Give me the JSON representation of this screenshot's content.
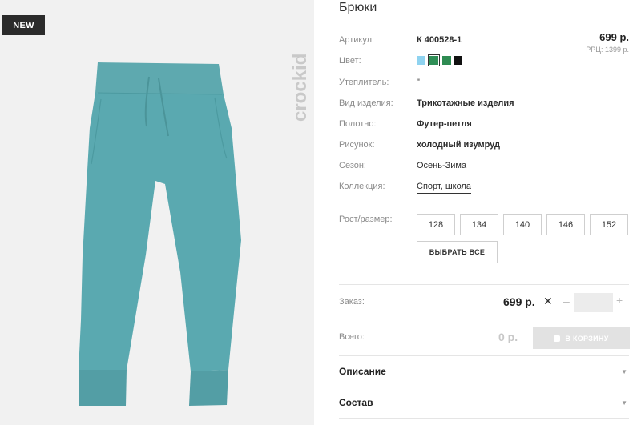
{
  "product": {
    "badge": "NEW",
    "brand": "crockid",
    "title": "Брюки",
    "price": "699 р.",
    "rrp": "РРЦ: 1399 р."
  },
  "attributes": [
    {
      "label": "Артикул:",
      "value": "К 400528-1"
    },
    {
      "label": "Цвет:",
      "value": ""
    },
    {
      "label": "Утеплитель:",
      "value": "\""
    },
    {
      "label": "Вид изделия:",
      "value": "Трикотажные изделия"
    },
    {
      "label": "Полотно:",
      "value": "Футер-петля"
    },
    {
      "label": "Рисунок:",
      "value": "холодный изумруд"
    },
    {
      "label": "Сезон:",
      "value": "Осень-Зима"
    },
    {
      "label": "Коллекция:",
      "value": "Спорт, школа"
    }
  ],
  "swatches": [
    {
      "color": "#8fd3f0",
      "icon": "color-swatch-icon"
    },
    {
      "color": "#2f8f57",
      "icon": "color-swatch-icon",
      "selected": true
    },
    {
      "color": "#2e8b52",
      "icon": "color-swatch-icon"
    },
    {
      "color": "#111111",
      "icon": "color-swatch-icon"
    }
  ],
  "sizes": {
    "label": "Рост/размер:",
    "options": [
      "128",
      "134",
      "140",
      "146",
      "152"
    ],
    "select_all": "ВЫБРАТЬ ВСЕ"
  },
  "order": {
    "label": "Заказ:",
    "price": "699 р.",
    "times": "✕",
    "minus": "–",
    "plus": "+",
    "quantity": "",
    "total_label": "Всего:",
    "total": "0 р.",
    "cart_button": "В КОРЗИНУ"
  },
  "accordion": [
    {
      "title": "Описание",
      "icon": "chevron-down-icon"
    },
    {
      "title": "Состав",
      "icon": "chevron-down-icon"
    }
  ],
  "colors": {
    "product": "#5aa9b0",
    "badge_bg": "#2b2b2b",
    "photo_bg": "#f1f1f1"
  }
}
